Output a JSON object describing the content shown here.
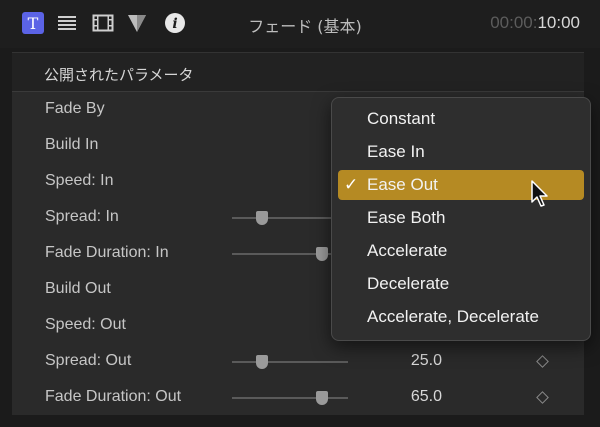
{
  "toolbar": {
    "text_tool_glyph": "T",
    "info_glyph": "i",
    "title": "フェード (基本)",
    "timecode_dim": "00:00:",
    "timecode_main": "10:00",
    "accent": "#5b63e6"
  },
  "inspector": {
    "section_title": "公開されたパラメータ",
    "params": [
      {
        "label": "Fade By"
      },
      {
        "label": "Build In"
      },
      {
        "label": "Speed: In"
      },
      {
        "label": "Spread: In"
      },
      {
        "label": "Fade Duration: In"
      },
      {
        "label": "Build Out"
      },
      {
        "label": "Speed: Out"
      },
      {
        "label": "Spread: Out",
        "value": "25.0"
      },
      {
        "label": "Fade Duration: Out",
        "value": "65.0"
      }
    ]
  },
  "menu": {
    "items": [
      {
        "label": "Constant",
        "selected": false
      },
      {
        "label": "Ease In",
        "selected": false
      },
      {
        "label": "Ease Out",
        "selected": true
      },
      {
        "label": "Ease Both",
        "selected": false
      },
      {
        "label": "Accelerate",
        "selected": false
      },
      {
        "label": "Decelerate",
        "selected": false
      },
      {
        "label": "Accelerate, Decelerate",
        "selected": false
      }
    ],
    "checkmark": "✓",
    "highlight_color": "#b58a23"
  }
}
